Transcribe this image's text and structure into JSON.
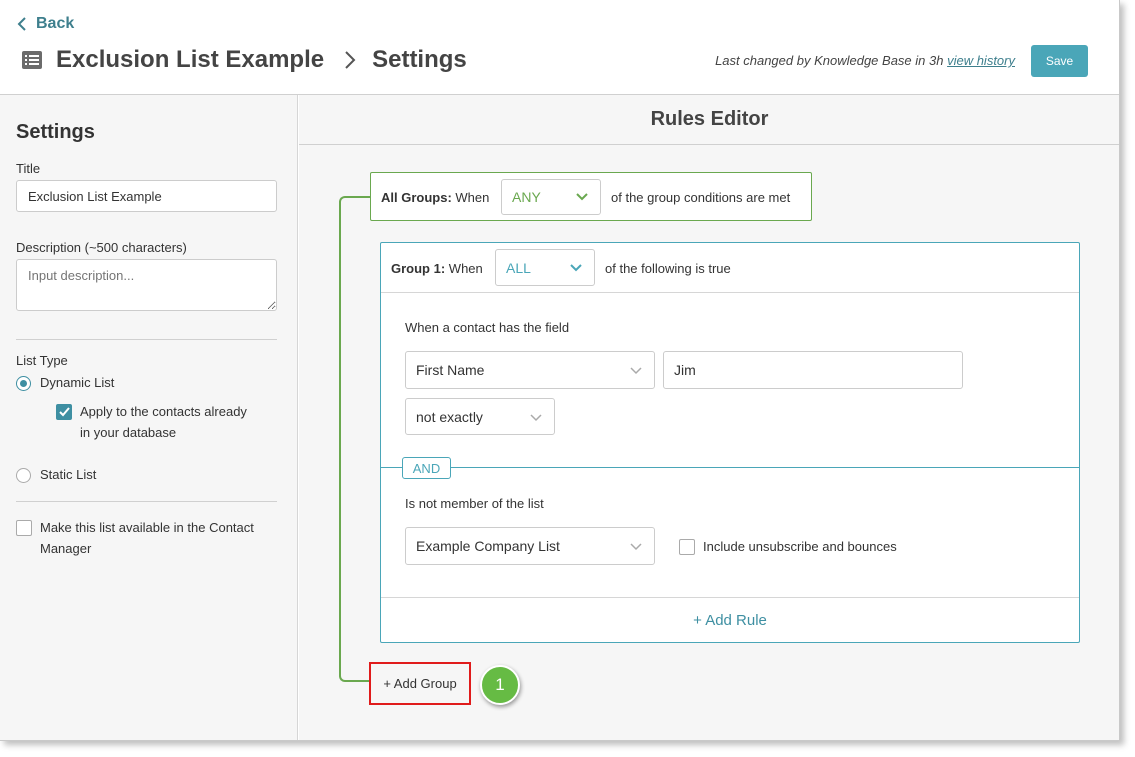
{
  "header": {
    "back_label": "Back",
    "title": "Exclusion List Example",
    "breadcrumb_current": "Settings",
    "last_changed_text": "Last changed by Knowledge Base in 3h",
    "view_history_label": "view history",
    "save_label": "Save"
  },
  "sidebar": {
    "heading": "Settings",
    "title_label": "Title",
    "title_value": "Exclusion List Example",
    "description_label": "Description (~500 characters)",
    "description_placeholder": "Input description...",
    "list_type_label": "List Type",
    "dynamic_list_label": "Dynamic List",
    "dynamic_selected": true,
    "apply_existing_line1": "Apply to the contacts already",
    "apply_existing_line2": "in your database",
    "apply_existing_checked": true,
    "static_list_label": "Static List",
    "contact_manager_line1": "Make this list available in the Contact",
    "contact_manager_line2": "Manager",
    "contact_manager_checked": false
  },
  "editor": {
    "heading": "Rules Editor",
    "all_groups": {
      "label_bold": "All Groups:",
      "label_when": "When",
      "selected": "ANY",
      "suffix": "of the group conditions are met"
    },
    "group1": {
      "label_bold": "Group 1:",
      "label_when": "When",
      "selected": "ALL",
      "suffix": "of the following is true",
      "rule1": {
        "label": "When a contact has the field",
        "field": "First Name",
        "value": "Jim",
        "operator": "not exactly"
      },
      "connector": "AND",
      "rule2": {
        "label": "Is not member of the list",
        "list": "Example Company List",
        "include_label": "Include unsubscribe and bounces",
        "include_checked": false
      },
      "add_rule_label": "+ Add Rule"
    },
    "add_group_label": "+ Add Group",
    "step_badge": "1"
  },
  "colors": {
    "accent": "#4aa6b8",
    "green": "#6aa84f",
    "highlight_red": "#e01b1b",
    "badge_green": "#66bb44"
  }
}
